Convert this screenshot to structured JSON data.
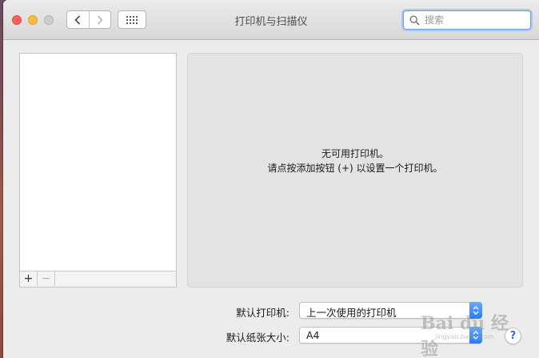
{
  "window": {
    "title": "打印机与扫描仪"
  },
  "search": {
    "placeholder": "搜索"
  },
  "printer_list": {
    "add_label": "+",
    "remove_label": "−"
  },
  "detail": {
    "empty_line1": "无可用打印机。",
    "empty_line2": "请点按添加按钮 (+) 以设置一个打印机。"
  },
  "settings": {
    "default_printer_label": "默认打印机:",
    "default_printer_value": "上一次使用的打印机",
    "default_paper_label": "默认纸张大小:",
    "default_paper_value": "A4"
  },
  "help": {
    "label": "?"
  },
  "watermark": {
    "text": "Bai du 经验",
    "sub": "jingyan.baidu.com"
  },
  "colors": {
    "accent": "#2a7bf2",
    "close": "#fc615d",
    "minimize": "#fdbc40"
  }
}
